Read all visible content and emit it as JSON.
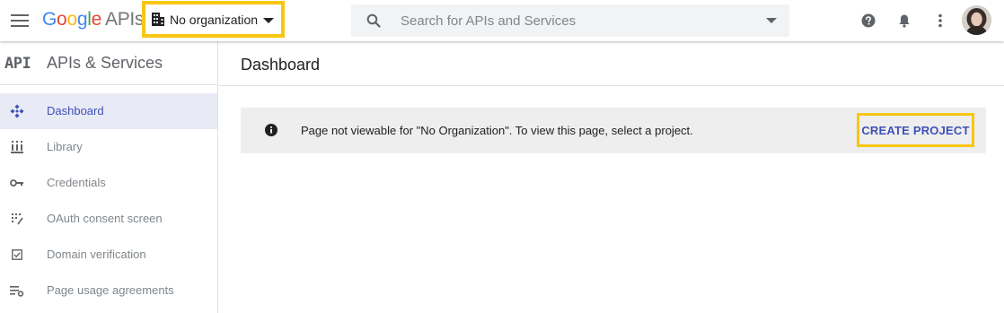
{
  "header": {
    "menu_icon": "hamburger-menu-icon",
    "logo": {
      "google": "Google",
      "apis": "APIs"
    },
    "org_picker": {
      "icon": "building-icon",
      "label": "No organization"
    },
    "search": {
      "icon": "search-icon",
      "placeholder": "Search for APIs and Services"
    },
    "icons": [
      "help-icon",
      "notifications-icon",
      "more-vert-icon",
      "avatar"
    ]
  },
  "sidebar": {
    "badge": "API",
    "title": "APIs & Services",
    "items": [
      {
        "label": "Dashboard",
        "icon": "dashboard-icon",
        "active": true
      },
      {
        "label": "Library",
        "icon": "library-icon",
        "active": false
      },
      {
        "label": "Credentials",
        "icon": "key-icon",
        "active": false
      },
      {
        "label": "OAuth consent screen",
        "icon": "oauth-icon",
        "active": false
      },
      {
        "label": "Domain verification",
        "icon": "checkbox-icon",
        "active": false
      },
      {
        "label": "Page usage agreements",
        "icon": "settings-list-icon",
        "active": false
      }
    ]
  },
  "main": {
    "title": "Dashboard",
    "notice": {
      "icon": "info-icon",
      "text": "Page not viewable for \"No Organization\". To view this page, select a project.",
      "action": "CREATE PROJECT"
    }
  },
  "colors": {
    "accent": "#3f51b5",
    "highlight_border": "#f9c612",
    "active_nav_bg": "#e8eaf6",
    "notice_bg": "#eeeeee"
  }
}
